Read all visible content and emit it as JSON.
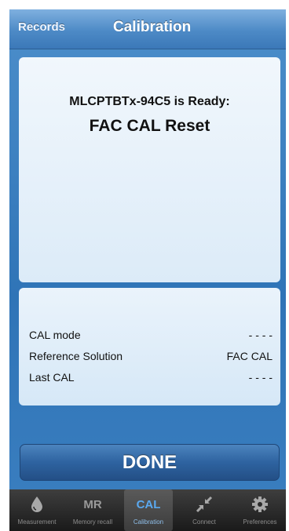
{
  "navbar": {
    "back_label": "Records",
    "title": "Calibration"
  },
  "status": {
    "device_line": "MLCPTBTx-94C5 is Ready:",
    "status_line": "FAC CAL Reset"
  },
  "info": {
    "rows": [
      {
        "label": "CAL mode",
        "value": "- - - -"
      },
      {
        "label": "Reference Solution",
        "value": "FAC CAL"
      },
      {
        "label": "Last CAL",
        "value": "- - - -"
      }
    ]
  },
  "done_label": "DONE",
  "tabbar": {
    "active_color": "#5aa9f0",
    "tabs": [
      {
        "icon": "drop-icon",
        "glyph": "",
        "label": "Measurement"
      },
      {
        "icon": "mr-text-icon",
        "glyph": "MR",
        "label": "Memory recall"
      },
      {
        "icon": "cal-text-icon",
        "glyph": "CAL",
        "label": "Calibration"
      },
      {
        "icon": "connect-arrows-icon",
        "glyph": "",
        "label": "Connect"
      },
      {
        "icon": "gear-icon",
        "glyph": "",
        "label": "Preferences"
      }
    ]
  }
}
